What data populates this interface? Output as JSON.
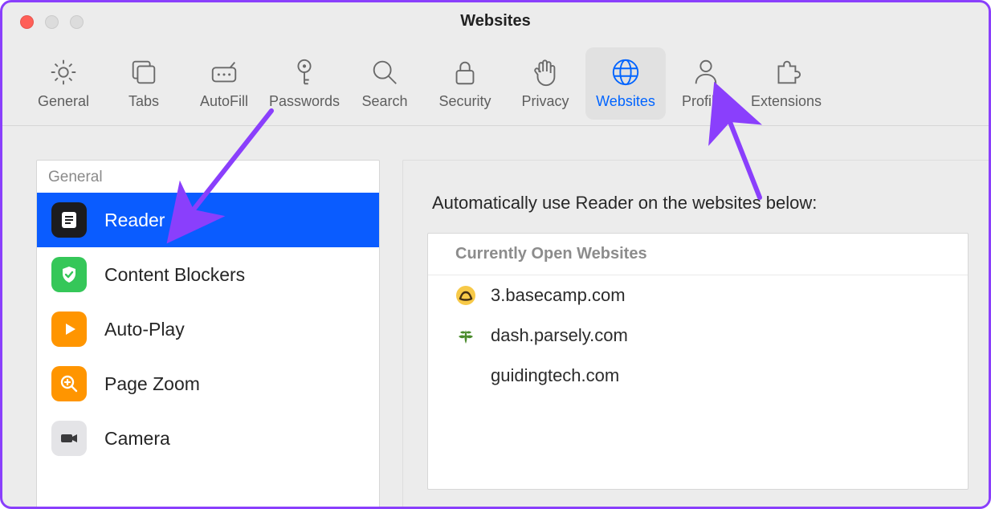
{
  "window": {
    "title": "Websites"
  },
  "toolbar": {
    "items": [
      {
        "label": "General"
      },
      {
        "label": "Tabs"
      },
      {
        "label": "AutoFill"
      },
      {
        "label": "Passwords"
      },
      {
        "label": "Search"
      },
      {
        "label": "Security"
      },
      {
        "label": "Privacy"
      },
      {
        "label": "Websites"
      },
      {
        "label": "Profiles"
      },
      {
        "label": "Extensions"
      }
    ],
    "active_index": 7
  },
  "sidebar": {
    "section_header": "General",
    "items": [
      {
        "label": "Reader",
        "icon": "reader-icon",
        "selected": true
      },
      {
        "label": "Content Blockers",
        "icon": "shield-check-icon",
        "selected": false
      },
      {
        "label": "Auto-Play",
        "icon": "play-icon",
        "selected": false
      },
      {
        "label": "Page Zoom",
        "icon": "zoom-icon",
        "selected": false
      },
      {
        "label": "Camera",
        "icon": "camera-icon",
        "selected": false
      }
    ]
  },
  "main": {
    "heading": "Automatically use Reader on the websites below:",
    "section_header": "Currently Open Websites",
    "sites": [
      {
        "domain": "3.basecamp.com",
        "favicon": "basecamp"
      },
      {
        "domain": "dash.parsely.com",
        "favicon": "parsely"
      },
      {
        "domain": "guidingtech.com",
        "favicon": "none"
      }
    ]
  },
  "annotations": {
    "arrow1_target": "sidebar-item-reader",
    "arrow2_target": "toolbar-item-websites",
    "color": "#8a3ffc"
  }
}
